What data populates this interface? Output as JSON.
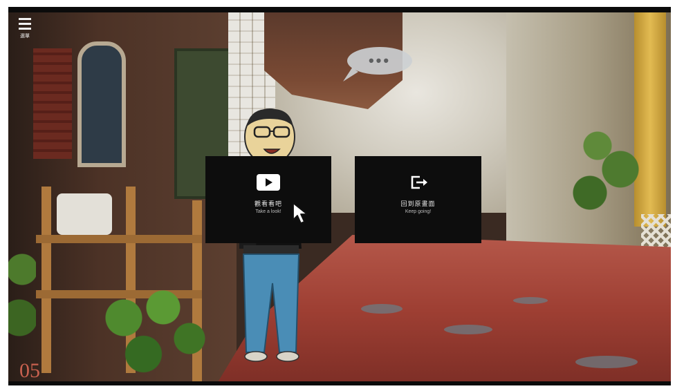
{
  "menu": {
    "label": "選單",
    "icon": "hamburger-menu-icon"
  },
  "speech_bubble": {
    "text": "•••"
  },
  "choices": [
    {
      "title": "觀看看吧",
      "subtitle": "Take a look!",
      "icon": "play-icon"
    },
    {
      "title": "回到原畫面",
      "subtitle": "Keep going!",
      "icon": "exit-icon"
    }
  ],
  "chapter": {
    "number": "05"
  },
  "colors": {
    "card_bg": "#0d0d0d",
    "chapter_accent": "#c9614f",
    "text_light": "#e6e6e6"
  }
}
